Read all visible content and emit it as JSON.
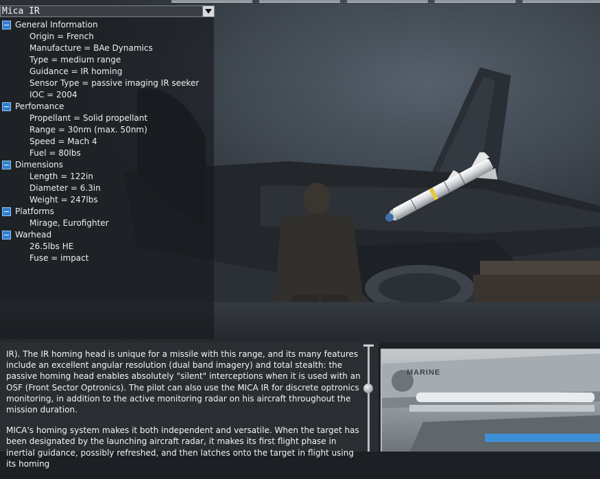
{
  "window": {
    "title": "Mica IR"
  },
  "tree": {
    "sections": [
      {
        "label": "General Information",
        "items": [
          "Origin = French",
          "Manufacture = BAe Dynamics",
          "Type = medium range",
          "Guidance = IR homing",
          "Sensor Type = passive imaging IR seeker",
          "IOC = 2004"
        ]
      },
      {
        "label": "Perfomance",
        "items": [
          "Propellant = Solid propellant",
          "Range = 30nm (max. 50nm)",
          "Speed = Mach 4",
          "Fuel = 80lbs"
        ]
      },
      {
        "label": "Dimensions",
        "items": [
          "Length = 122in",
          "Diameter = 6.3in",
          "Weight = 247lbs"
        ]
      },
      {
        "label": "Platforms",
        "items": [
          "Mirage, Eurofighter"
        ]
      },
      {
        "label": "Warhead",
        "items": [
          "26.5lbs HE",
          "Fuse = impact"
        ]
      }
    ]
  },
  "description": {
    "paragraphs": [
      "IR). The IR homing head is unique for a missile with this range, and its many features include an excellent angular resolution (dual band imagery) and total stealth: the passive homing head enables absolutely \"silent\" interceptions when it is used with an OSF (Front Sector Optronics). The pilot can also use the MICA IR for discrete optronics monitoring, in addition to the active monitoring radar on his aircraft throughout the mission duration.",
      "MICA's homing system makes it both independent and versatile. When the target has been designated by the launching aircraft radar, it makes its first flight phase in inertial guidance, possibly refreshed, and then latches onto the target in flight using its homing"
    ]
  },
  "photo": {
    "label": "MARINE"
  },
  "colors": {
    "toggle": "#2f7fd0",
    "panel_bg": "#14161a",
    "text": "#eef0f2"
  }
}
